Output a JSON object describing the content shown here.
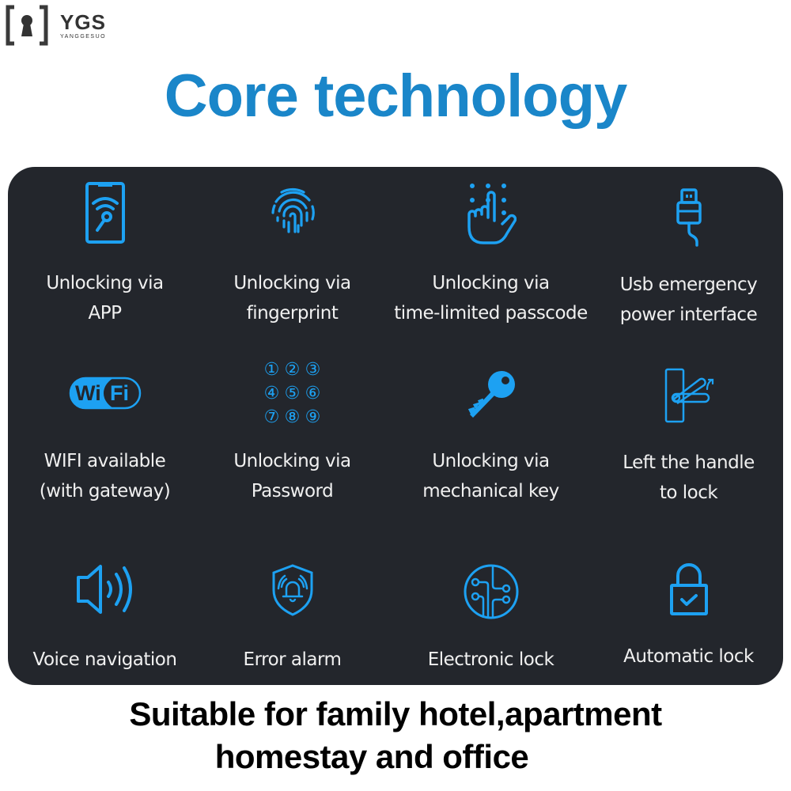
{
  "brand": {
    "name": "YGS",
    "subtitle": "YANGGESUO"
  },
  "title": "Core technology",
  "accent_color": "#1da1f2",
  "features": [
    {
      "icon": "phone-app-key-icon",
      "line1": "Unlocking via",
      "line2": "APP"
    },
    {
      "icon": "fingerprint-icon",
      "line1": "Unlocking via",
      "line2": "fingerprint"
    },
    {
      "icon": "touch-passcode-icon",
      "line1": "Unlocking via",
      "line2": "time-limited passcode"
    },
    {
      "icon": "usb-plug-icon",
      "line1": "Usb emergency",
      "line2": "power interface"
    },
    {
      "icon": "wifi-icon",
      "line1": "WIFI available",
      "line2": "(with gateway)",
      "wifi_left": "Wi",
      "wifi_right": "Fi"
    },
    {
      "icon": "keypad-icon",
      "line1": "Unlocking via",
      "line2": "Password",
      "keys": [
        "①",
        "②",
        "③",
        "④",
        "⑤",
        "⑥",
        "⑦",
        "⑧",
        "⑨"
      ]
    },
    {
      "icon": "key-icon",
      "line1": "Unlocking via",
      "line2": "mechanical key"
    },
    {
      "icon": "door-handle-icon",
      "line1": "Left the handle",
      "line2": "to lock"
    },
    {
      "icon": "speaker-icon",
      "line1": "Voice navigation",
      "line2": ""
    },
    {
      "icon": "shield-alarm-icon",
      "line1": "Error alarm",
      "line2": ""
    },
    {
      "icon": "circuit-icon",
      "line1": "Electronic lock",
      "line2": ""
    },
    {
      "icon": "padlock-check-icon",
      "line1": "Automatic lock",
      "line2": ""
    }
  ],
  "footer": {
    "line1": "Suitable for family hotel,apartment",
    "line2": "homestay and office"
  }
}
